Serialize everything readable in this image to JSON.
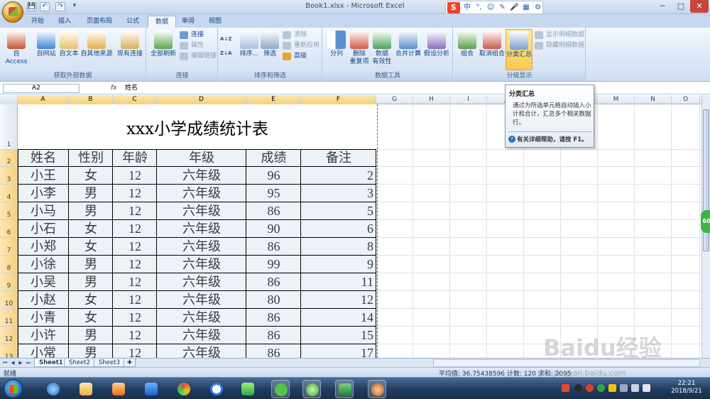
{
  "window": {
    "title": "Book1.xlsx - Microsoft Excel",
    "qat_save": "💾",
    "qat_undo": "↶",
    "qat_redo": "↷",
    "qat_more": "▾",
    "min": "─",
    "max": "□",
    "close": "✕"
  },
  "ime": {
    "logo": "S",
    "lang": "中",
    "punct": "°,",
    "emoji": "☺",
    "skin": "✎",
    "voice": "🎤",
    "grid": "▦",
    "tools": "⚙"
  },
  "tabs": [
    "开始",
    "插入",
    "页面布局",
    "公式",
    "数据",
    "审阅",
    "视图"
  ],
  "ribbon": {
    "groups": {
      "external": "获取外部数据",
      "connections": "连接",
      "sortfilter": "排序和筛选",
      "datatools": "数据工具",
      "outline": "分级显示"
    },
    "buttons": {
      "from_access": "自 Access",
      "from_web": "自网站",
      "from_text": "自文本",
      "from_other": "自其他来源",
      "existing": "现有连接",
      "refresh_all": "全部刷新",
      "connections": "连接",
      "properties": "属性",
      "edit_links": "编辑链接",
      "sort_az": "A↓Z",
      "sort_za": "Z↓A",
      "sort": "排序...",
      "filter": "筛选",
      "clear": "清除",
      "reapply": "重新应用",
      "advanced": "高级",
      "text_to_columns": "分列",
      "remove_dup": "删除\n重复项",
      "validation": "数据\n有效性",
      "consolidate": "合并计算",
      "whatif": "假设分析",
      "group": "组合",
      "ungroup": "取消组合",
      "subtotal": "分类汇总",
      "show_detail": "显示明细数据",
      "hide_detail": "隐藏明细数据"
    }
  },
  "formula_bar": {
    "name_box": "A2",
    "fx": "fx",
    "content": "姓名"
  },
  "columns": [
    "A",
    "B",
    "C",
    "D",
    "E",
    "F",
    "G",
    "H",
    "I",
    "J",
    "K",
    "L",
    "M",
    "N",
    "O"
  ],
  "rows": [
    "1",
    "2",
    "3",
    "4",
    "5",
    "6",
    "7",
    "8",
    "9",
    "10",
    "11",
    "12",
    "13"
  ],
  "sheet": {
    "title": "xxx小学成绩统计表",
    "headers": [
      "姓名",
      "性别",
      "年龄",
      "年级",
      "成绩",
      "备注"
    ],
    "data": [
      [
        "小王",
        "女",
        "12",
        "六年级",
        "96",
        "2"
      ],
      [
        "小李",
        "男",
        "12",
        "六年级",
        "95",
        "3"
      ],
      [
        "小马",
        "男",
        "12",
        "六年级",
        "86",
        "5"
      ],
      [
        "小石",
        "女",
        "12",
        "六年级",
        "90",
        "6"
      ],
      [
        "小郑",
        "女",
        "12",
        "六年级",
        "86",
        "8"
      ],
      [
        "小徐",
        "男",
        "12",
        "六年级",
        "99",
        "9"
      ],
      [
        "小吴",
        "男",
        "12",
        "六年级",
        "86",
        "11"
      ],
      [
        "小赵",
        "女",
        "12",
        "六年级",
        "80",
        "12"
      ],
      [
        "小青",
        "女",
        "12",
        "六年级",
        "86",
        "14"
      ],
      [
        "小许",
        "男",
        "12",
        "六年级",
        "86",
        "15"
      ],
      [
        "小常",
        "男",
        "12",
        "六年级",
        "86",
        "17"
      ]
    ]
  },
  "tooltip": {
    "title": "分类汇总",
    "body": "通过为所选单元格自动插入小计和合计，汇总多个相关数据行。",
    "help": "有关详细帮助，请按 F1。"
  },
  "side_badge": "60",
  "sheet_tabs": [
    "Sheet1",
    "Sheet2",
    "Sheet3"
  ],
  "status": {
    "ready": "就绪",
    "summary": "平均值: 36.75438596    计数: 120    求和: 2095"
  },
  "watermark": {
    "text": "Baidu经验",
    "url": "jingyan.baidu.com"
  },
  "taskbar": {
    "time": "22:21",
    "date": "2018/9/21"
  }
}
